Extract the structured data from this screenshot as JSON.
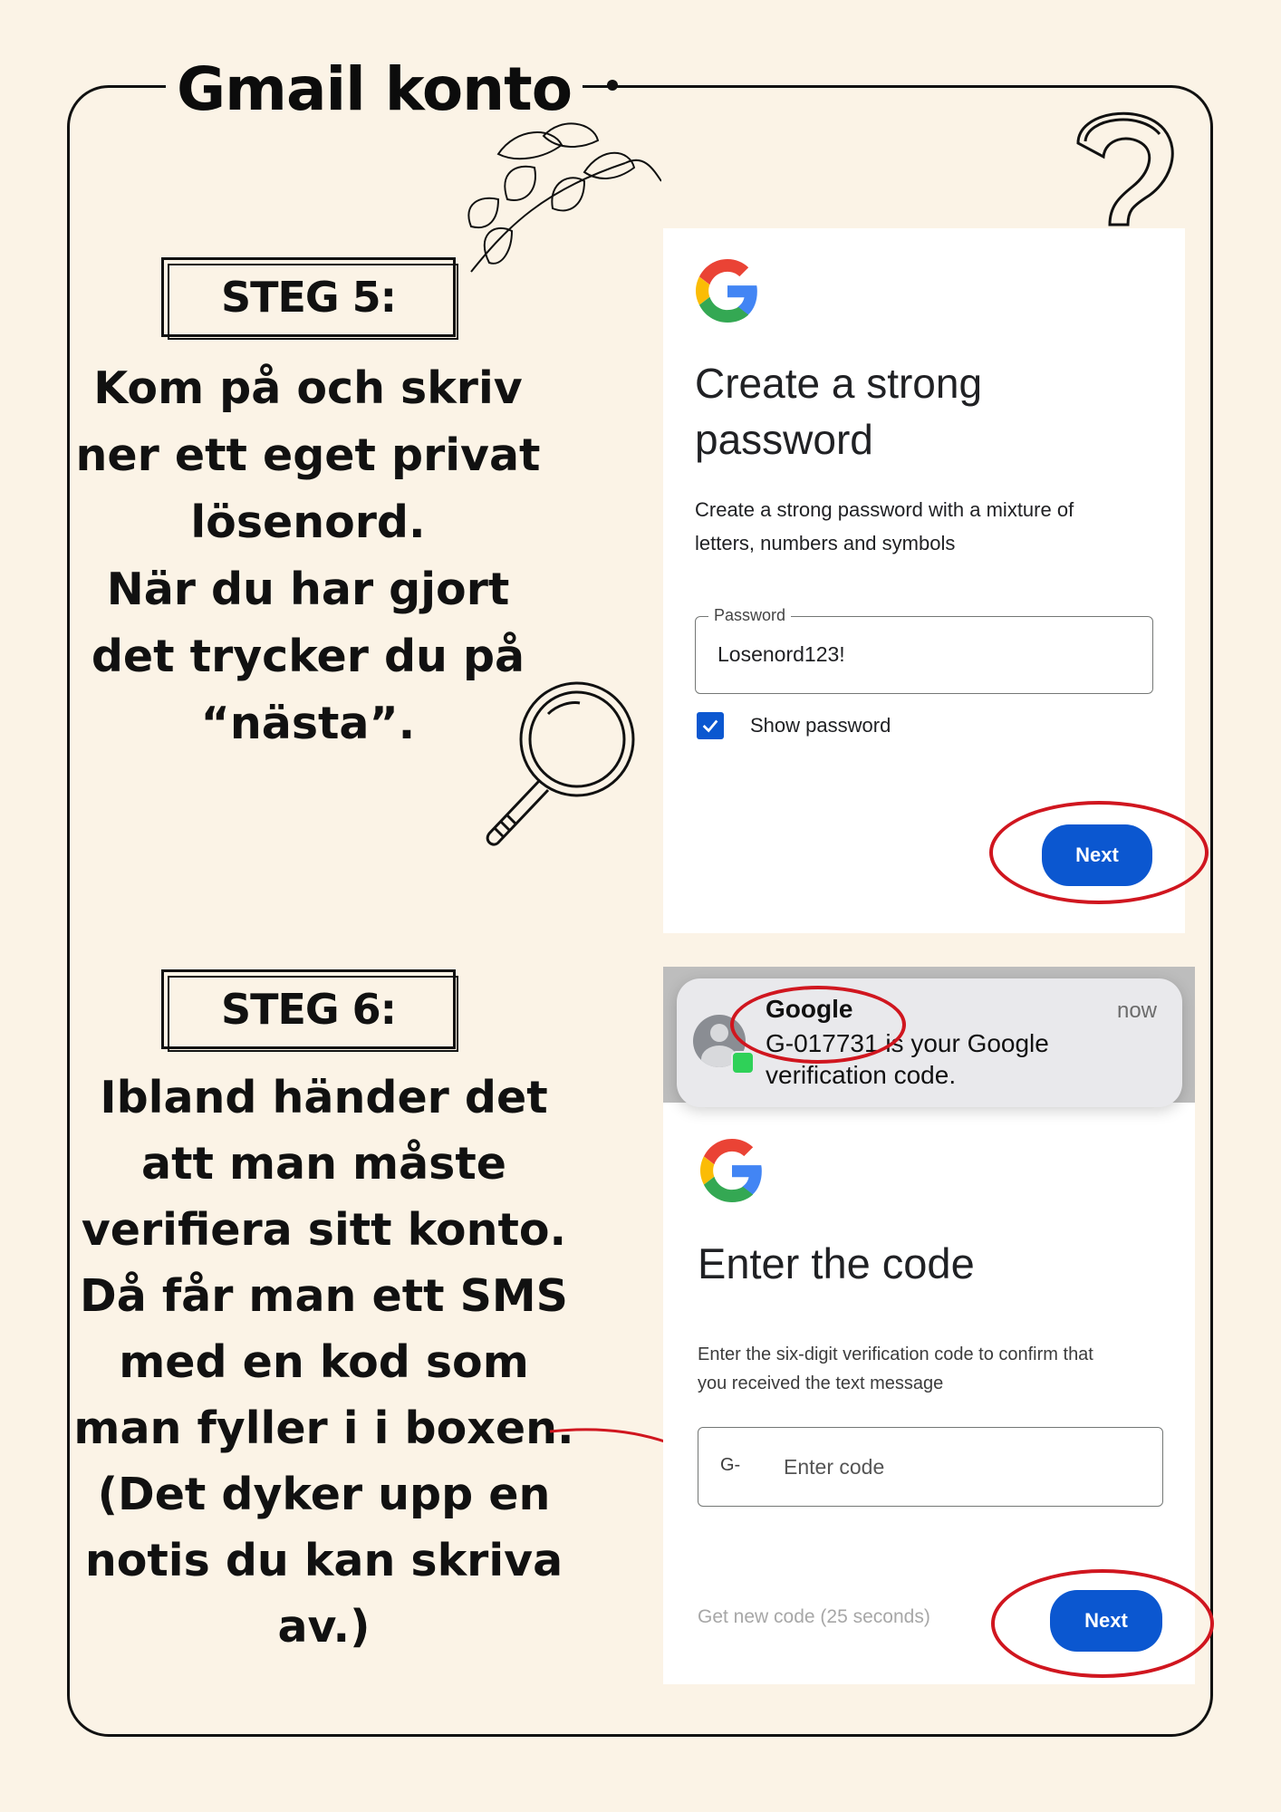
{
  "page": {
    "title": "Gmail konto"
  },
  "step5": {
    "label": "STEG 5:",
    "instruction": [
      "Kom på och skriv",
      "ner ett eget privat",
      "lösenord.",
      "När du har gjort",
      "det trycker du på",
      "“nästa”."
    ]
  },
  "step6": {
    "label": "STEG 6:",
    "instruction": [
      "Ibland händer det",
      "att man måste",
      "verifiera sitt konto.",
      "Då får man ett SMS",
      "med en kod som",
      "man fyller i i boxen.",
      "(Det dyker upp en",
      "notis du kan skriva",
      "av.)"
    ]
  },
  "password_screen": {
    "title_line1": "Create a strong",
    "title_line2": "password",
    "desc_line1": "Create a strong password with a mixture of",
    "desc_line2": "letters, numbers and symbols",
    "field_label": "Password",
    "field_value": "Losenord123!",
    "checkbox_label": "Show password",
    "checkbox_checked": true,
    "next_label": "Next"
  },
  "notification": {
    "sender": "Google",
    "time": "now",
    "line1": "G-017731 is your Google",
    "line2": "verification code."
  },
  "code_screen": {
    "title": "Enter the code",
    "desc_line1": "Enter the six-digit verification code to confirm that",
    "desc_line2": "you received the text message",
    "prefix": "G-",
    "placeholder": "Enter code",
    "resend": "Get new code (25 seconds)",
    "next_label": "Next"
  },
  "colors": {
    "background": "#FBF3E6",
    "google_blue": "#0B57D0",
    "highlight_red": "#D0161F"
  }
}
